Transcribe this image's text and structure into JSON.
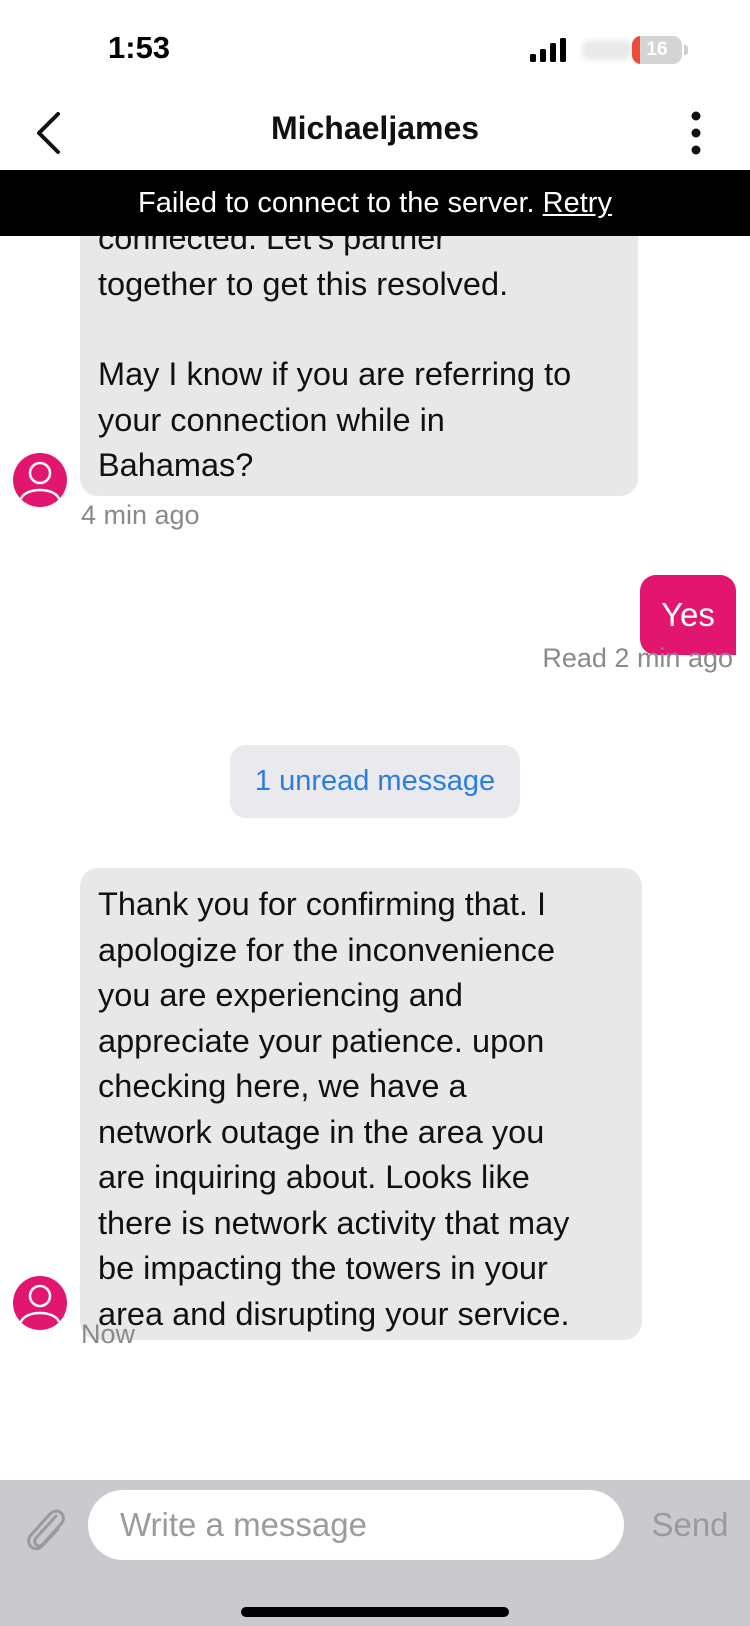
{
  "status_bar": {
    "time": "1:53",
    "battery_level": "16",
    "battery_fraction": 0.16
  },
  "header": {
    "title": "Michaeljames",
    "back_icon": "chevron-left-icon",
    "more_icon": "more-vertical-icon"
  },
  "banner": {
    "message": "Failed to connect to the server.",
    "action": "Retry"
  },
  "messages": [
    {
      "from": "agent",
      "lines": [
        "connected. Let’s partner",
        "together to get this resolved."
      ],
      "lines2": [
        "May I know if you are referring to",
        "your connection while in",
        "Bahamas?"
      ],
      "meta": "4 min ago"
    },
    {
      "from": "user",
      "text": "Yes",
      "meta": "Read 2 min ago"
    },
    {
      "from": "agent",
      "lines": [
        "Thank you for confirming that. I",
        "apologize for the inconvenience",
        "you are experiencing and",
        "appreciate your patience. upon",
        "checking here, we have a",
        "network outage in the area you",
        "are inquiring about. Looks like",
        "there is network activity that may",
        "be impacting the towers in your",
        "area and disrupting your service."
      ],
      "meta": "Now"
    }
  ],
  "unread_divider": "1 unread message",
  "composer": {
    "placeholder": "Write a message",
    "send_label": "Send",
    "attach_icon": "paperclip-icon"
  },
  "colors": {
    "brand": "#e2166f",
    "agent_bubble": "#e8e8e8",
    "link": "#2a7de1",
    "banner": "#000000",
    "composer_bg": "#c9c9ce"
  }
}
